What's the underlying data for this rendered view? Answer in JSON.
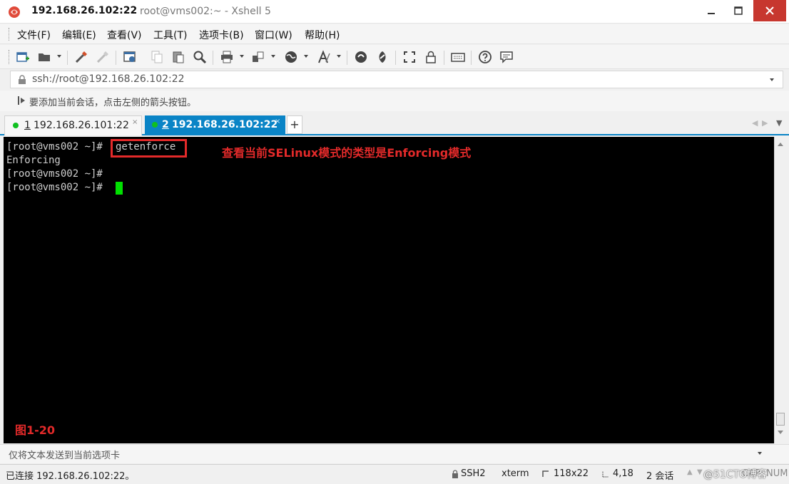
{
  "window": {
    "title_host": "192.168.26.102:22",
    "title_app": "root@vms002:~ - Xshell 5",
    "icons": [
      "xshell-logo-icon",
      "minimize-icon",
      "maximize-icon",
      "close-icon"
    ]
  },
  "menu": {
    "items": [
      "文件(F)",
      "编辑(E)",
      "查看(V)",
      "工具(T)",
      "选项卡(B)",
      "窗口(W)",
      "帮助(H)"
    ]
  },
  "toolbar": {
    "icons": [
      "new-session-icon",
      "open-folder-icon",
      "connect-icon",
      "disconnect-icon",
      "properties-icon",
      "copy-icon",
      "paste-icon",
      "find-icon",
      "print-icon",
      "transfer-icon",
      "globe-icon",
      "font-icon",
      "xftp-icon",
      "xmanager-icon",
      "fullscreen-icon",
      "lock-icon",
      "keyboard-icon",
      "help-icon",
      "chat-icon"
    ]
  },
  "address": {
    "value": "ssh://root@192.168.26.102:22"
  },
  "info": {
    "text": "要添加当前会话，点击左侧的箭头按钮。"
  },
  "tabs": [
    {
      "index": "1",
      "label": "192.168.26.101:22",
      "status_color": "#10c020",
      "active": false
    },
    {
      "index": "2",
      "label": "192.168.26.102:22",
      "status_color": "#10c020",
      "active": true
    }
  ],
  "tab_add_label": "+",
  "terminal": {
    "prompt1": "[root@vms002 ~]#",
    "command": "getenforce",
    "output": "Enforcing",
    "prompt2": "[root@vms002 ~]#",
    "prompt3": "[root@vms002 ~]#",
    "annotation": "查看当前SELinux模式的类型是Enforcing模式",
    "figure_label": "图1-20",
    "highlight_color": "#e32a2a",
    "cursor_color": "#00e000"
  },
  "compose": {
    "placeholder": "仅将文本发送到当前选项卡"
  },
  "status": {
    "connection": "已连接 192.168.26.102:22。",
    "protocol": "SSH2",
    "terminal_type": "xterm",
    "size": "118x22",
    "cursor_pos": "4,18",
    "sessions": "2 会话",
    "caps": "CAP",
    "num": "NUM",
    "watermark": "@51CTO博客"
  }
}
